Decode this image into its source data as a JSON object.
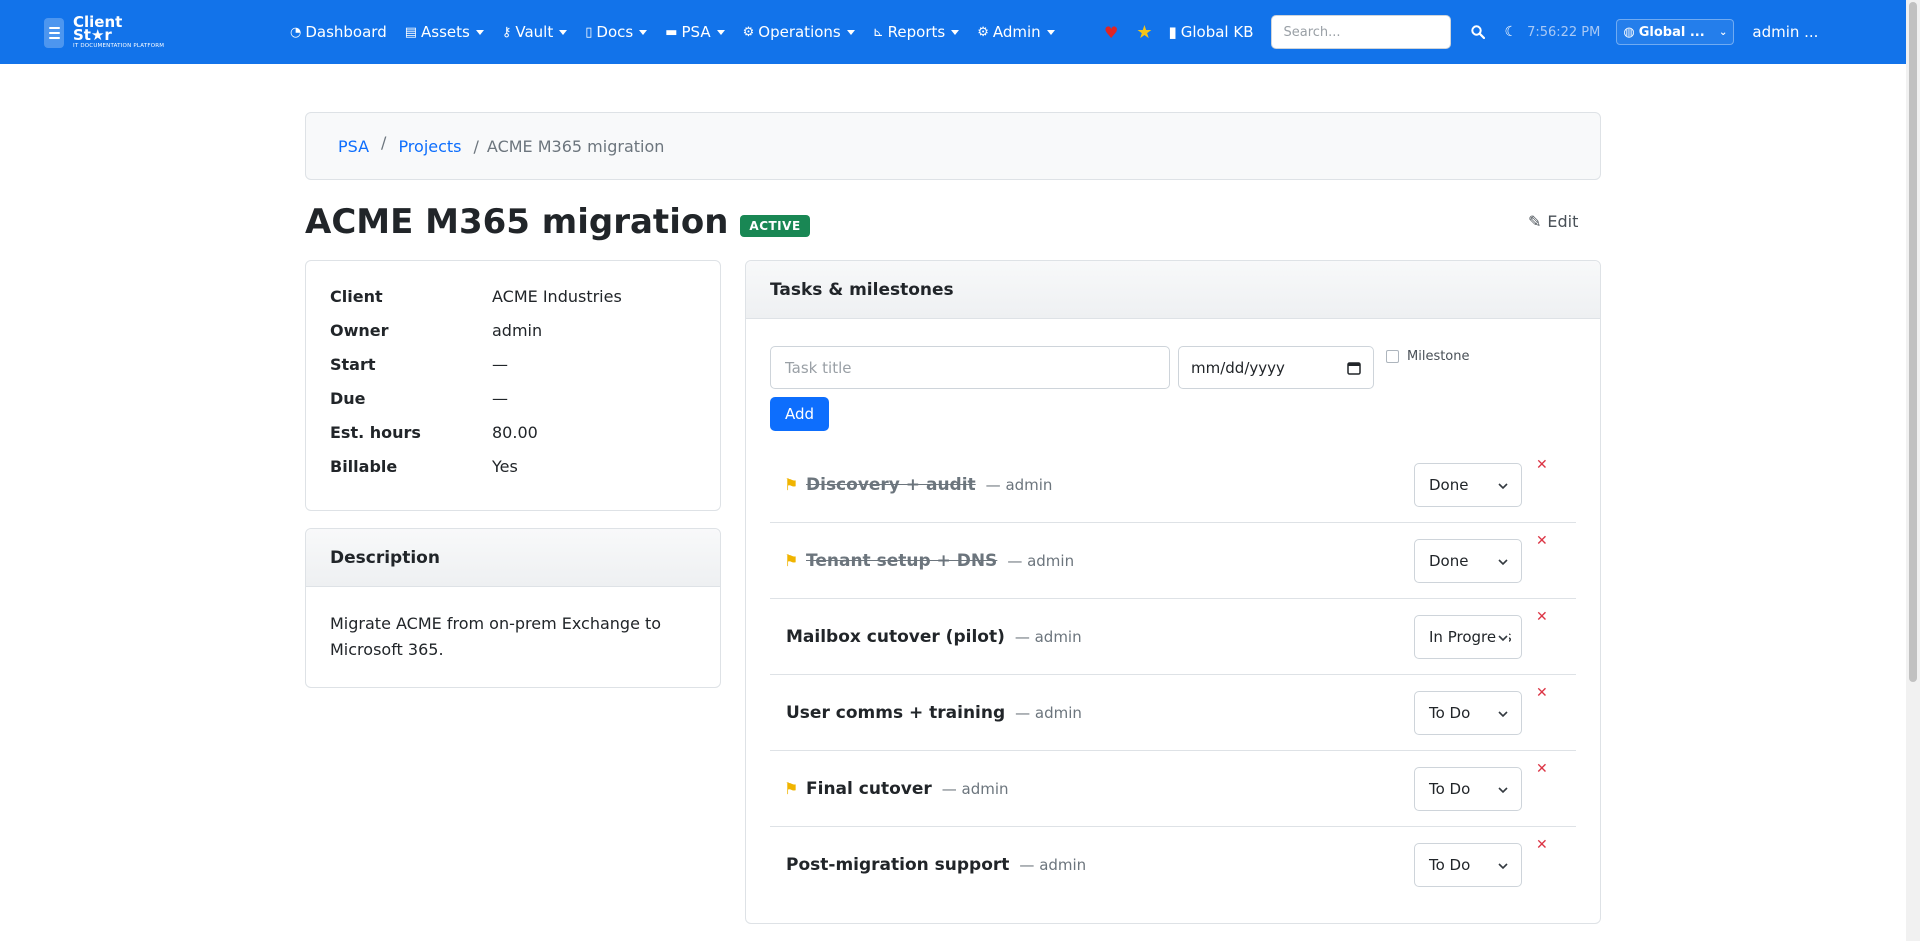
{
  "brand": {
    "name_line1": "Client",
    "name_line2": "St★r",
    "tagline": "IT DOCUMENTATION PLATFORM"
  },
  "nav": {
    "items": [
      {
        "label": "Dashboard",
        "icon": "dashboard-icon",
        "dropdown": false
      },
      {
        "label": "Assets",
        "icon": "assets-icon",
        "dropdown": true
      },
      {
        "label": "Vault",
        "icon": "key-icon",
        "dropdown": true
      },
      {
        "label": "Docs",
        "icon": "document-icon",
        "dropdown": true
      },
      {
        "label": "PSA",
        "icon": "ticket-icon",
        "dropdown": true
      },
      {
        "label": "Operations",
        "icon": "gears-icon",
        "dropdown": true
      },
      {
        "label": "Reports",
        "icon": "chart-icon",
        "dropdown": true
      },
      {
        "label": "Admin",
        "icon": "gear-icon",
        "dropdown": true
      }
    ],
    "kb_label": "Global KB",
    "search_placeholder": "Search...",
    "clock": "7:56:22 PM",
    "scope": "Global ...",
    "user": "admin ..."
  },
  "breadcrumb": {
    "psa": "PSA",
    "projects": "Projects",
    "current": "ACME M365 migration"
  },
  "project": {
    "title": "ACME M365 migration",
    "status": "ACTIVE",
    "edit_label": "Edit",
    "details": [
      {
        "key": "Client",
        "value": "ACME Industries"
      },
      {
        "key": "Owner",
        "value": "admin"
      },
      {
        "key": "Start",
        "value": "—"
      },
      {
        "key": "Due",
        "value": "—"
      },
      {
        "key": "Est. hours",
        "value": "80.00"
      },
      {
        "key": "Billable",
        "value": "Yes"
      }
    ],
    "description_header": "Description",
    "description": "Migrate ACME from on-prem Exchange to Microsoft 365."
  },
  "tasks": {
    "header": "Tasks & milestones",
    "title_placeholder": "Task title",
    "date_placeholder": "mm/dd/yyyy",
    "milestone_label": "Milestone",
    "add_label": "Add",
    "items": [
      {
        "title": "Discovery + audit",
        "owner": "— admin",
        "status": "Done",
        "milestone": true,
        "done": true
      },
      {
        "title": "Tenant setup + DNS",
        "owner": "— admin",
        "status": "Done",
        "milestone": true,
        "done": true
      },
      {
        "title": "Mailbox cutover (pilot)",
        "owner": "— admin",
        "status": "In Progress",
        "milestone": false,
        "done": false
      },
      {
        "title": "User comms + training",
        "owner": "— admin",
        "status": "To Do",
        "milestone": false,
        "done": false
      },
      {
        "title": "Final cutover",
        "owner": "— admin",
        "status": "To Do",
        "milestone": true,
        "done": false
      },
      {
        "title": "Post-migration support",
        "owner": "— admin",
        "status": "To Do",
        "milestone": false,
        "done": false
      }
    ]
  },
  "colors": {
    "navbar": "#1273ea",
    "primary": "#0d6efd",
    "success": "#198754",
    "danger": "#dc3545",
    "milestone_flag": "#f0b400"
  }
}
